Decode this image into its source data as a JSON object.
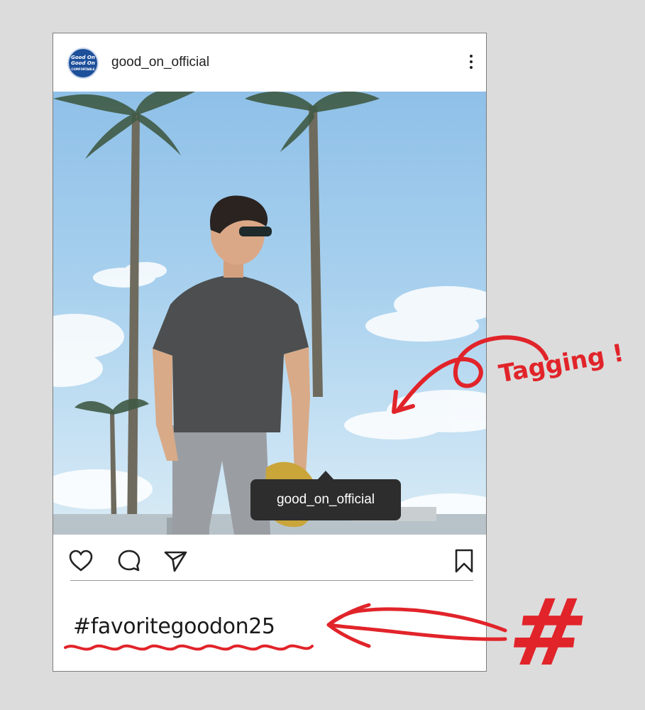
{
  "post": {
    "username": "good_on_official",
    "avatar": {
      "line1": "Good On",
      "line2": "Good On",
      "line3": "COMFORTABLE"
    },
    "tag_label": "good_on_official",
    "caption": "#favoritegoodon25",
    "icons": {
      "more": "more-vertical-icon",
      "like": "heart-icon",
      "comment": "comment-icon",
      "share": "send-icon",
      "save": "bookmark-icon"
    }
  },
  "annotations": {
    "tagging_text": "Tagging !",
    "hashtag_symbol": "#"
  },
  "colors": {
    "annotation_red": "#e1242a",
    "tag_bubble": "#2d2d2d",
    "avatar_blue": "#1d4f9a"
  }
}
